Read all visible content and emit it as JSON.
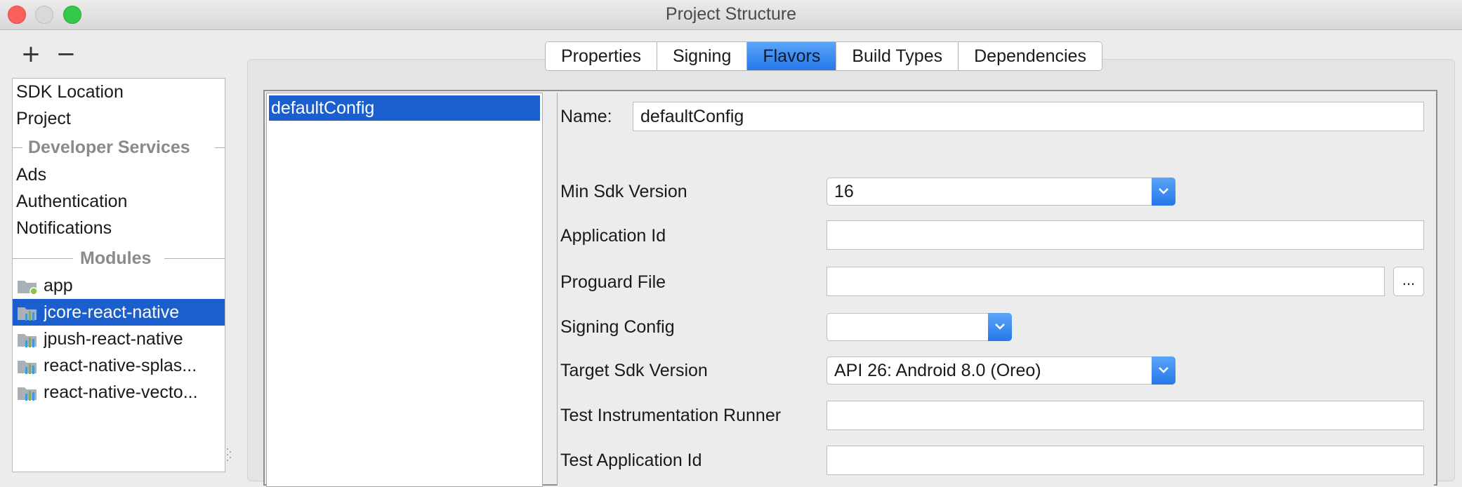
{
  "window": {
    "title": "Project Structure"
  },
  "toolbar": {
    "add": "+",
    "remove": "−"
  },
  "sidebar": {
    "items": [
      {
        "label": "SDK Location"
      },
      {
        "label": "Project"
      }
    ],
    "developer_services": {
      "header": "Developer Services",
      "items": [
        {
          "label": "Ads"
        },
        {
          "label": "Authentication"
        },
        {
          "label": "Notifications"
        }
      ]
    },
    "modules": {
      "header": "Modules",
      "items": [
        {
          "label": "app",
          "icon": "android-module-folder-icon",
          "selected": false
        },
        {
          "label": "jcore-react-native",
          "icon": "library-module-icon",
          "selected": true
        },
        {
          "label": "jpush-react-native",
          "icon": "library-module-icon",
          "selected": false
        },
        {
          "label": "react-native-splas...",
          "icon": "library-module-icon",
          "selected": false
        },
        {
          "label": "react-native-vecto...",
          "icon": "library-module-icon",
          "selected": false
        }
      ]
    }
  },
  "tabs": [
    {
      "label": "Properties",
      "active": false
    },
    {
      "label": "Signing",
      "active": false
    },
    {
      "label": "Flavors",
      "active": true
    },
    {
      "label": "Build Types",
      "active": false
    },
    {
      "label": "Dependencies",
      "active": false
    }
  ],
  "flavors": {
    "items": [
      {
        "label": "defaultConfig",
        "selected": true
      }
    ]
  },
  "form": {
    "name": {
      "label": "Name:",
      "value": "defaultConfig"
    },
    "min_sdk": {
      "label": "Min Sdk Version",
      "value": "16"
    },
    "application_id": {
      "label": "Application Id",
      "value": ""
    },
    "proguard_file": {
      "label": "Proguard File",
      "value": "",
      "browse": "..."
    },
    "signing_config": {
      "label": "Signing Config",
      "value": ""
    },
    "target_sdk": {
      "label": "Target Sdk Version",
      "value": "API 26: Android 8.0 (Oreo)"
    },
    "test_runner": {
      "label": "Test Instrumentation Runner",
      "value": ""
    },
    "test_app_id": {
      "label": "Test Application Id",
      "value": ""
    }
  },
  "colors": {
    "selection": "#1b5fce",
    "accent_blue": "#2478e9",
    "close": "#fc605b",
    "maximize": "#34c84a"
  }
}
